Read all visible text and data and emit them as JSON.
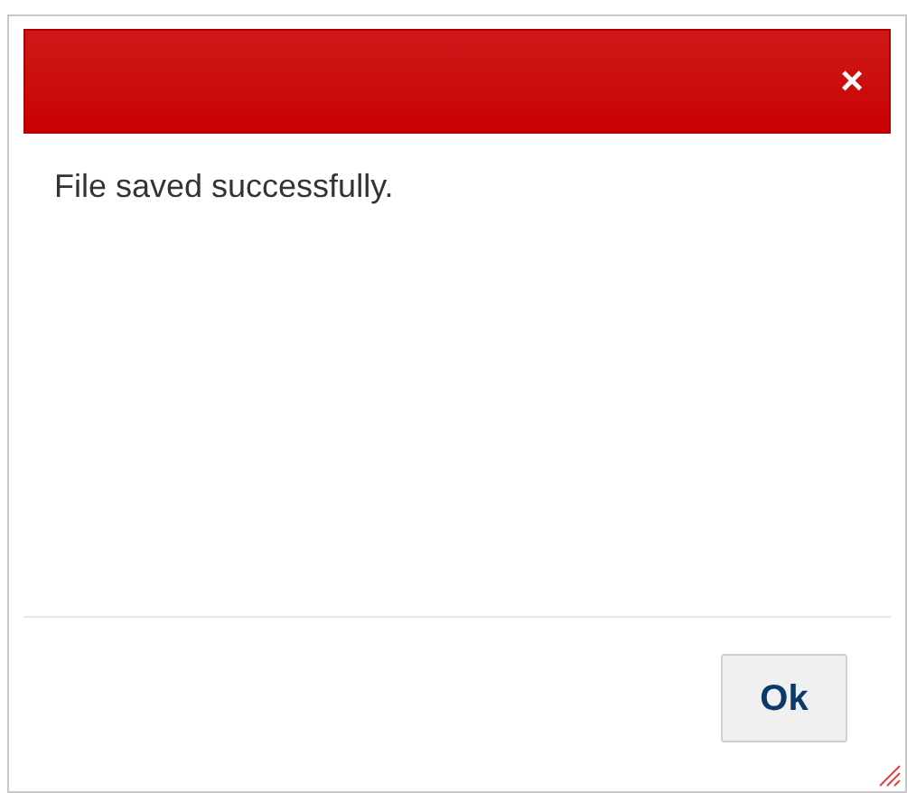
{
  "dialog": {
    "close": "×",
    "message": "File saved successfully.",
    "buttons": [
      "Ok"
    ]
  }
}
